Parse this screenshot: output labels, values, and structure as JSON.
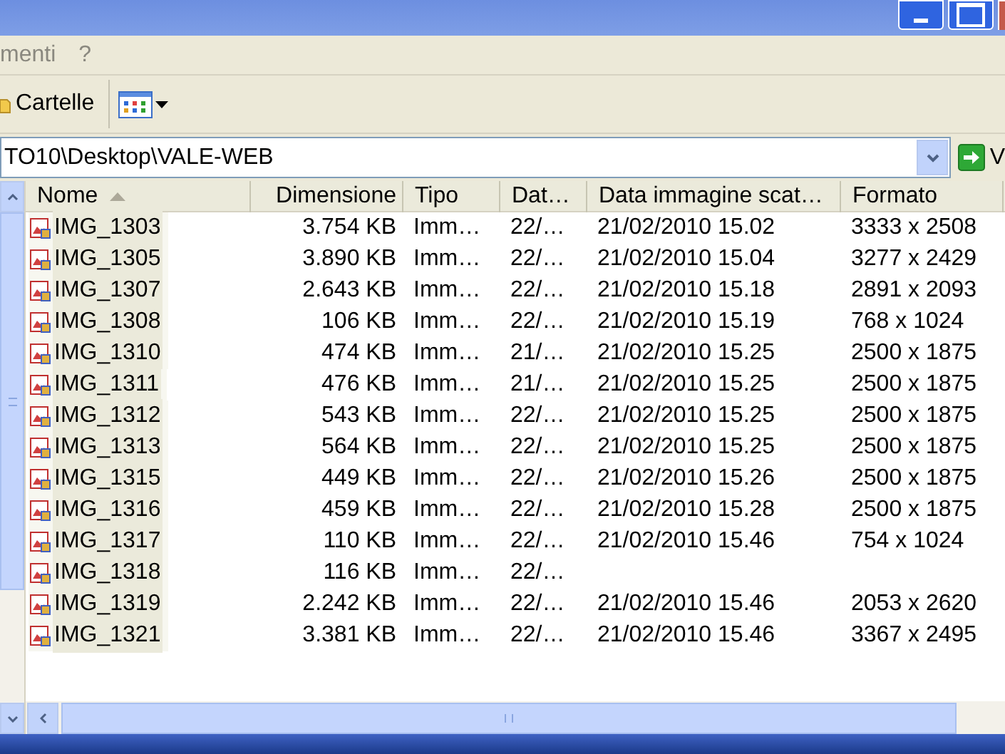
{
  "menu_bar": [
    "menti",
    "?"
  ],
  "toolbar": {
    "folders_button": "Cartelle"
  },
  "address_bar": {
    "value": "TO10\\Desktop\\VALE-WEB",
    "go_button": "V"
  },
  "table": {
    "columns": [
      {
        "label": "Nome",
        "sorted": true
      },
      {
        "label": "Dimensione",
        "sorted": false
      },
      {
        "label": "Tipo",
        "sorted": false
      },
      {
        "label": "Dat…",
        "sorted": false
      },
      {
        "label": "Data immagine scat…",
        "sorted": false
      },
      {
        "label": "Formato",
        "sorted": false
      }
    ],
    "rows": [
      [
        "IMG_1303",
        "3.754 KB",
        "Imm…",
        "22/…",
        "21/02/2010 15.02",
        "3333 x 2508"
      ],
      [
        "IMG_1305",
        "3.890 KB",
        "Imm…",
        "22/…",
        "21/02/2010 15.04",
        "3277 x 2429"
      ],
      [
        "IMG_1307",
        "2.643 KB",
        "Imm…",
        "22/…",
        "21/02/2010 15.18",
        "2891 x 2093"
      ],
      [
        "IMG_1308",
        "106 KB",
        "Imm…",
        "22/…",
        "21/02/2010 15.19",
        "768 x 1024"
      ],
      [
        "IMG_1310",
        "474 KB",
        "Imm…",
        "21/…",
        "21/02/2010 15.25",
        "2500 x 1875"
      ],
      [
        "IMG_1311",
        "476 KB",
        "Imm…",
        "21/…",
        "21/02/2010 15.25",
        "2500 x 1875"
      ],
      [
        "IMG_1312",
        "543 KB",
        "Imm…",
        "22/…",
        "21/02/2010 15.25",
        "2500 x 1875"
      ],
      [
        "IMG_1313",
        "564 KB",
        "Imm…",
        "22/…",
        "21/02/2010 15.25",
        "2500 x 1875"
      ],
      [
        "IMG_1315",
        "449 KB",
        "Imm…",
        "22/…",
        "21/02/2010 15.26",
        "2500 x 1875"
      ],
      [
        "IMG_1316",
        "459 KB",
        "Imm…",
        "22/…",
        "21/02/2010 15.28",
        "2500 x 1875"
      ],
      [
        "IMG_1317",
        "110 KB",
        "Imm…",
        "22/…",
        "21/02/2010 15.46",
        "754 x 1024"
      ],
      [
        "IMG_1318",
        "116 KB",
        "Imm…",
        "22/…",
        null,
        null
      ],
      [
        "IMG_1319",
        "2.242 KB",
        "Imm…",
        "22/…",
        "21/02/2010 15.46",
        "2053 x 2620"
      ],
      [
        "IMG_1321",
        "3.381 KB",
        "Imm…",
        "22/…",
        "21/02/2010 15.46",
        "3367 x 2495"
      ]
    ]
  }
}
